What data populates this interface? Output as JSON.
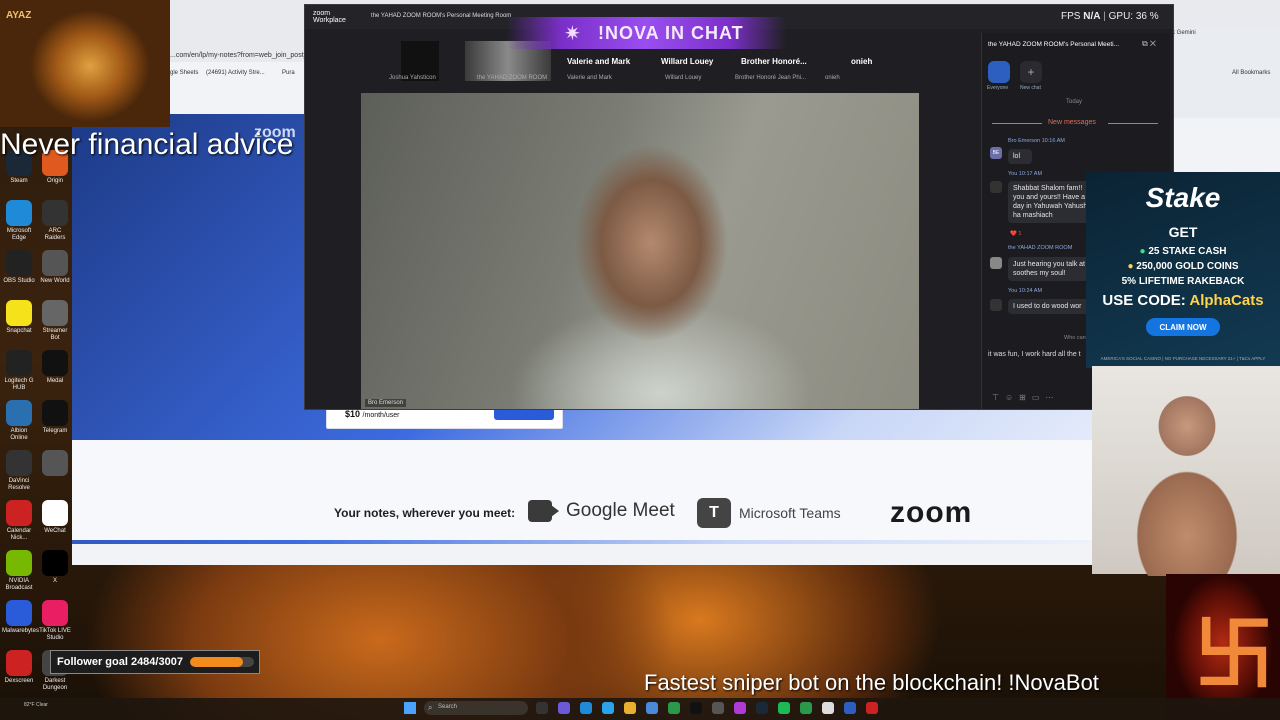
{
  "overlays": {
    "lion_tag": "AYAZ",
    "advice": "Never financial advice",
    "nova_banner": "!NOVA  IN CHAT",
    "follower_goal": "Follower goal 2484/3007",
    "follower_current": 2484,
    "follower_target": 3007,
    "ticker": "Fastest sniper bot on the blockchain! !NovaBot"
  },
  "stake_ad": {
    "logo": "Stake",
    "get": "GET",
    "line1": "25 STAKE CASH",
    "line2": "250,000 GOLD COINS",
    "line3": "5% LIFETIME RAKEBACK",
    "code_prefix": "USE CODE:",
    "code": "AlphaCats",
    "button": "CLAIM NOW",
    "fine_print": "AMERICA'S SOCIAL CASINO | NO PURCHASE NECESSARY          21+ | T&Cs APPLY"
  },
  "browser": {
    "url": "...com/en/lp/my-notes?from=web_join_post_...",
    "bookmarks": [
      "gle Sheets",
      "(24691) Activity Stre...",
      "Pura"
    ],
    "right_tab": "k Gemini",
    "all_bookmarks": "All Bookmarks",
    "hero_zoom": "zoom",
    "price": "$10",
    "price_unit": "/month/user",
    "notes_label": "Your notes, wherever you meet:",
    "gmeet": "Google Meet",
    "teams": "Microsoft Teams",
    "zoom": "zoom"
  },
  "zoom_window": {
    "brand_line1": "zoom",
    "brand_line2": "Workplace",
    "title": "the YAHAD ZOOM ROOM's Personal Meeting Room",
    "fps_label": "FPS",
    "fps_value": "N/A",
    "gpu": "GPU: 36 %",
    "participants": [
      {
        "name": "",
        "sub": "Joshua Yahsticon"
      },
      {
        "name": "",
        "sub": "the YAHAD ZOOM ROOM"
      },
      {
        "name": "Valerie and Mark",
        "sub": "Valerie and Mark"
      },
      {
        "name": "Willard Louey",
        "sub": "Willard Louey"
      },
      {
        "name": "Brother Honoré...",
        "sub": "Brother Honoré Jean Phi..."
      },
      {
        "name": "onieh",
        "sub": "onieh"
      }
    ],
    "video_tag": "Bro Emerson",
    "chat": {
      "header": "the YAHAD ZOOM ROOM's Personal Meeti...",
      "tab_everyone": "Everyone",
      "tab_new": "New chat",
      "today": "Today",
      "new_messages": "New messages",
      "messages": [
        {
          "meta": "Bro Emerson  10:16 AM",
          "avatar": "BE",
          "text": "lol"
        },
        {
          "meta": "You  10:17 AM",
          "avatar": "",
          "text": "Shabbat Shalom fam!! you and yours!! Have a day in Yahuwah Yahushua ha mashiach"
        },
        {
          "meta": "the YAHAD ZOOM ROOM",
          "avatar": "",
          "text": "Just hearing you talk at soothes my soul!"
        },
        {
          "meta": "You  10:24 AM",
          "avatar": "",
          "text": "I used to do wood wor"
        }
      ],
      "reaction": "❤️ 1",
      "who_can_see": "Who can see yo",
      "input": "it was fun, I work hard all the t"
    }
  },
  "desktop_icons": [
    {
      "label": "Steam",
      "color": "#1b2838"
    },
    {
      "label": "Origin",
      "color": "#e05a20"
    },
    {
      "label": "Microsoft Edge",
      "color": "#1f8ad8"
    },
    {
      "label": "ARC Raiders",
      "color": "#333"
    },
    {
      "label": "OBS Studio",
      "color": "#222"
    },
    {
      "label": "New World",
      "color": "#555"
    },
    {
      "label": "Snapchat",
      "color": "#f6e21b"
    },
    {
      "label": "Streamer Bot",
      "color": "#666"
    },
    {
      "label": "Logitech G HUB",
      "color": "#222"
    },
    {
      "label": "Medal",
      "color": "#111"
    },
    {
      "label": "Albion Online",
      "color": "#2a6fb0"
    },
    {
      "label": "Telegram",
      "color": "#111"
    },
    {
      "label": "DaVinci Resolve",
      "color": "#333"
    },
    {
      "label": "",
      "color": "#555"
    },
    {
      "label": "Calendar Nick...",
      "color": "#c22"
    },
    {
      "label": "WeChat",
      "color": "#fff"
    },
    {
      "label": "NVIDIA Broadcast",
      "color": "#76b900"
    },
    {
      "label": "X",
      "color": "#000"
    },
    {
      "label": "Malwarebytes",
      "color": "#2a5bd8"
    },
    {
      "label": "TikTok LIVE Studio",
      "color": "#e91e63"
    },
    {
      "label": "Dexscreen",
      "color": "#c22"
    },
    {
      "label": "Darkest Dungeon",
      "color": "#444"
    }
  ],
  "taskbar": {
    "weather": "82°F\nClear",
    "search": "Search"
  },
  "colors": {
    "accent": "#2a5bd8",
    "nova_purple": "#7b2fc9",
    "follower_orange": "#f28b1c"
  }
}
